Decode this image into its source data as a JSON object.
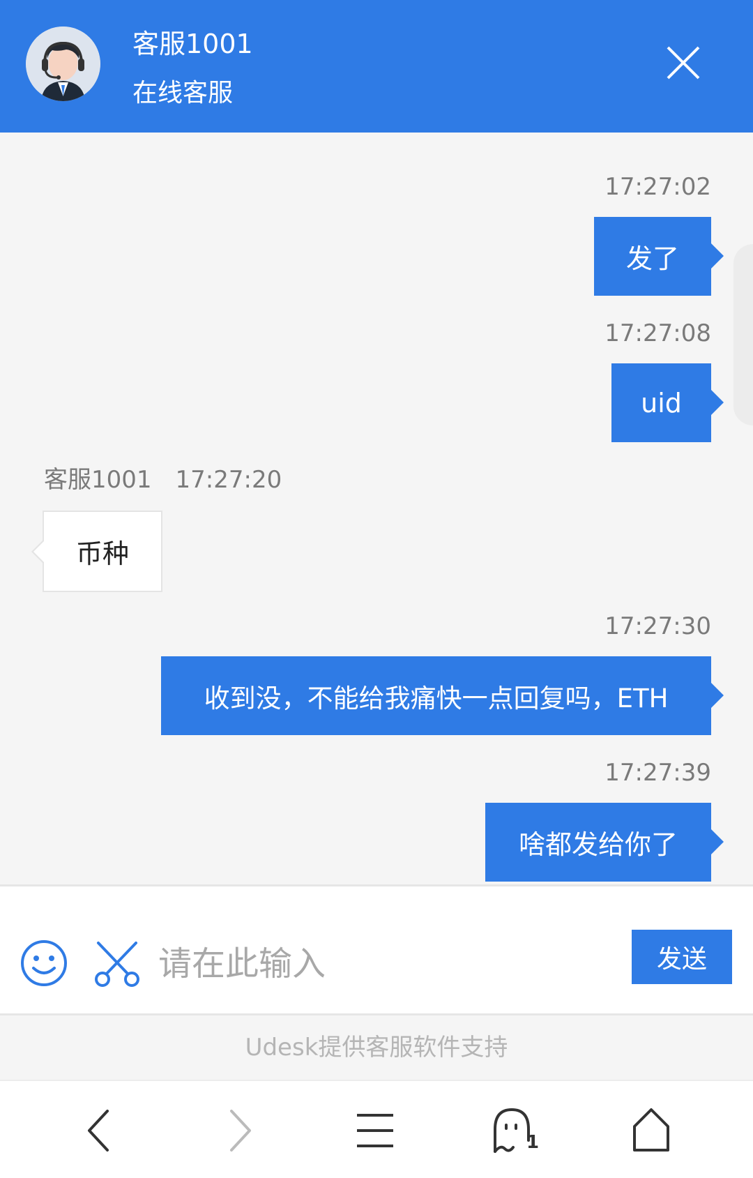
{
  "header": {
    "agent_name": "客服1001",
    "agent_status": "在线客服",
    "close_icon": "close-icon",
    "background_color": "#2f7be5"
  },
  "messages": [
    {
      "direction": "outgoing",
      "time": "17:27:02",
      "text": "发了"
    },
    {
      "direction": "outgoing",
      "time": "17:27:08",
      "text": "uid"
    },
    {
      "direction": "incoming",
      "sender": "客服1001",
      "time": "17:27:20",
      "text": "币种"
    },
    {
      "direction": "outgoing",
      "time": "17:27:30",
      "text": "收到没，不能给我痛快一点回复吗，ETH"
    },
    {
      "direction": "outgoing",
      "time": "17:27:39",
      "text": "啥都发给你了"
    }
  ],
  "input_bar": {
    "placeholder": "请在此输入",
    "value": "",
    "send_label": "发送",
    "emoji_icon": "smiley-icon",
    "screenshot_icon": "scissors-icon"
  },
  "footer": {
    "powered_by": "Udesk提供客服软件支持"
  },
  "browser_nav": {
    "back_icon": "chevron-left-icon",
    "forward_icon": "chevron-right-icon",
    "menu_icon": "menu-icon",
    "tabs_icon": "ghost-tabs-icon",
    "tabs_count": "1",
    "home_icon": "home-icon"
  }
}
